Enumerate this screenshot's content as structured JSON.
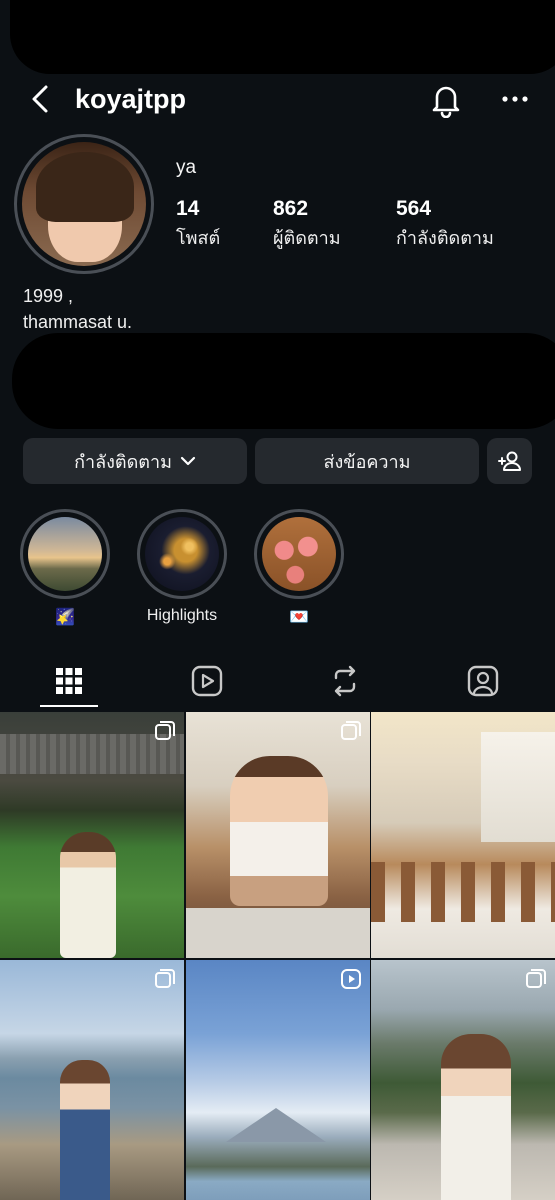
{
  "header": {
    "username": "koyajtpp"
  },
  "profile": {
    "display_name": "ya",
    "stats": [
      {
        "value": "14",
        "label": "โพสต์"
      },
      {
        "value": "862",
        "label": "ผู้ติดตาม"
      },
      {
        "value": "564",
        "label": "กำลังติดตาม"
      }
    ],
    "bio": [
      "1999 ,",
      "thammasat u."
    ]
  },
  "actions": {
    "following_label": "กำลังติดตาม",
    "message_label": "ส่งข้อความ"
  },
  "highlights": [
    {
      "label": "🌠"
    },
    {
      "label": "Highlights"
    },
    {
      "label": "💌"
    }
  ],
  "tabs": [
    {
      "icon": "grid-icon",
      "active": true
    },
    {
      "icon": "reels-icon",
      "active": false
    },
    {
      "icon": "repost-icon",
      "active": false
    },
    {
      "icon": "tagged-icon",
      "active": false
    }
  ],
  "posts": [
    {
      "type": "carousel",
      "scene": "garden-cafe"
    },
    {
      "type": "carousel",
      "scene": "restaurant-table"
    },
    {
      "type": "carousel",
      "scene": "dining-room"
    },
    {
      "type": "carousel",
      "scene": "lake-fuji"
    },
    {
      "type": "reel",
      "scene": "fuji-sky"
    },
    {
      "type": "carousel",
      "scene": "terrace-mountain"
    }
  ]
}
